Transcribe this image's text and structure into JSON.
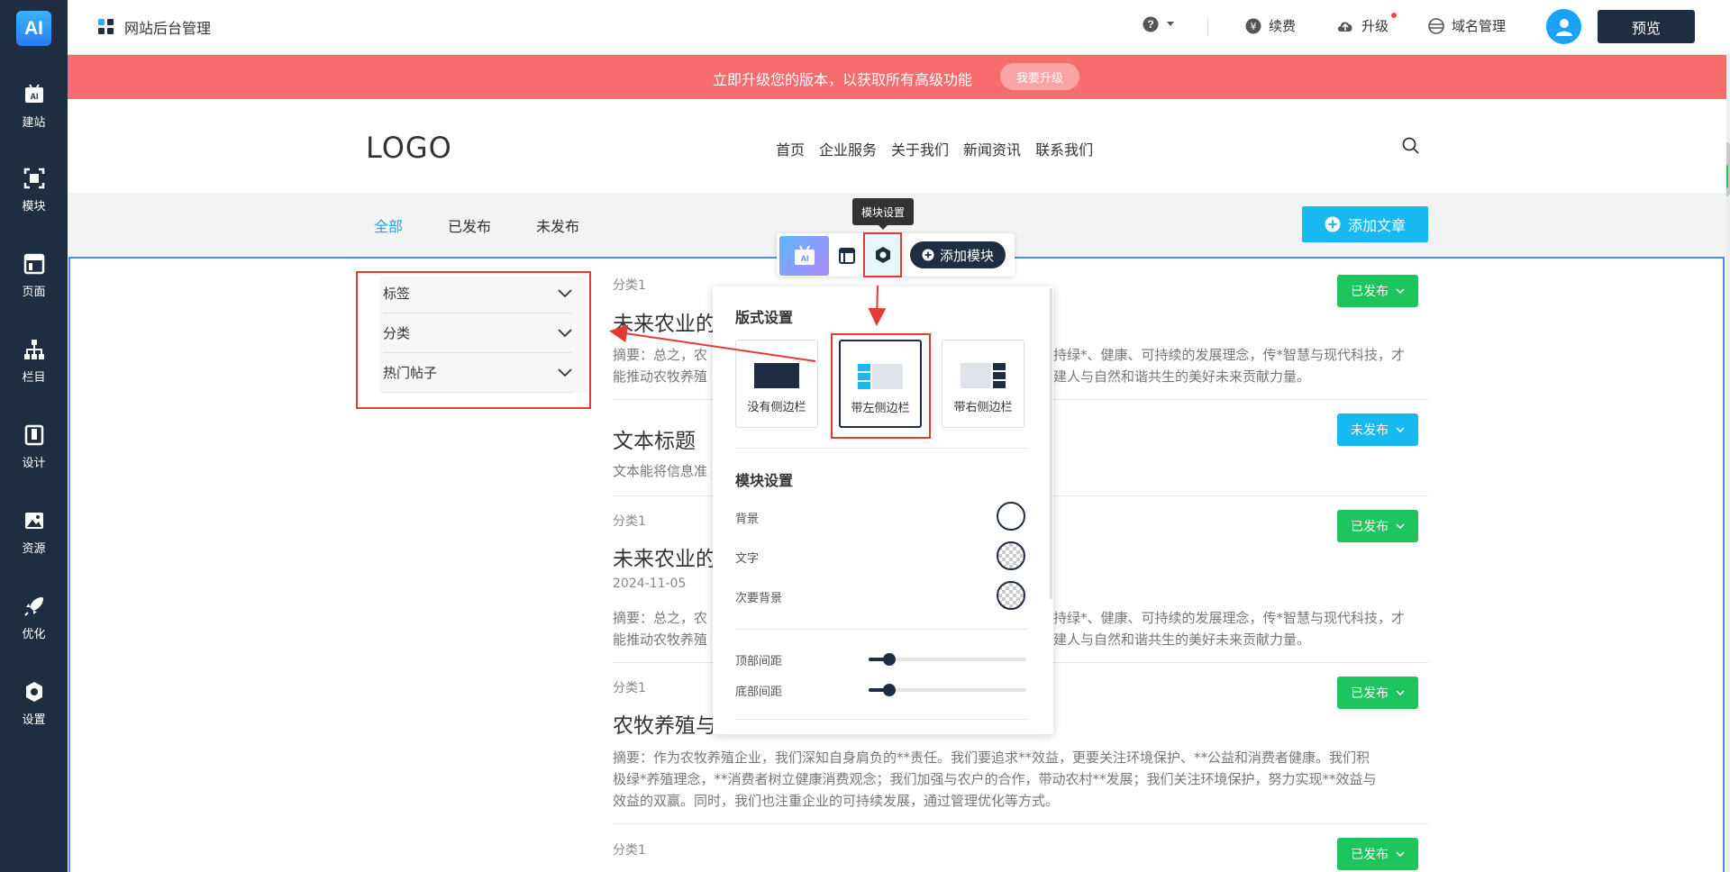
{
  "app": {
    "logo": "AI",
    "title": "网站后台管理"
  },
  "leftnav": [
    {
      "label": "建站",
      "icon": "ai-build-icon"
    },
    {
      "label": "模块",
      "icon": "module-icon"
    },
    {
      "label": "页面",
      "icon": "page-icon"
    },
    {
      "label": "栏目",
      "icon": "sitemap-icon"
    },
    {
      "label": "设计",
      "icon": "design-icon"
    },
    {
      "label": "资源",
      "icon": "image-icon"
    },
    {
      "label": "优化",
      "icon": "rocket-icon"
    },
    {
      "label": "设置",
      "icon": "gear-icon"
    }
  ],
  "topbar": {
    "renew": "续费",
    "upgrade": "升级",
    "domain": "域名管理",
    "preview": "预览"
  },
  "banner": {
    "text": "立即升级您的版本，以获取所有高级功能",
    "button": "我要升级"
  },
  "site": {
    "logo": "LOGO",
    "nav": [
      "首页",
      "企业服务",
      "关于我们",
      "新闻资讯",
      "联系我们"
    ]
  },
  "tabs": {
    "all": "全部",
    "published": "已发布",
    "unpublished": "未发布",
    "add_article": "添加文章"
  },
  "toolbar": {
    "tooltip": "模块设置",
    "add_module": "添加模块"
  },
  "sidebar": [
    "标签",
    "分类",
    "热门帖子"
  ],
  "articles": [
    {
      "category": "分类1",
      "title": "未来农业的",
      "summary1": "摘要：总之，农",
      "summary1_end": "持绿*、健康、可持续的发展理念，传*智慧与现代科技，才",
      "summary2": "能推动农牧养殖",
      "summary2_end": "建人与自然和谐共生的美好未来贡献力量。",
      "status": "已发布"
    },
    {
      "category": "",
      "title": "文本标题",
      "summary1": "文本能将信息准",
      "status": "未发布"
    },
    {
      "category": "分类1",
      "title": "未来农业的",
      "date": "2024-11-05",
      "summary1": "摘要：总之，农",
      "summary1_end": "持绿*、健康、可持续的发展理念，传*智慧与现代科技，才",
      "summary2": "能推动农牧养殖",
      "summary2_end": "建人与自然和谐共生的美好未来贡献力量。",
      "status": "已发布"
    },
    {
      "category": "分类1",
      "title": "农牧养殖与",
      "summary1": "摘要：作为农牧养殖企业，我们深知自身肩负的**责任。我们要追求**效益，更要关注环境保护、**公益和消费者健康。我们积",
      "summary2": "极绿*养殖理念，**消费者树立健康消费观念；我们加强与农户的合作，带动农村**发展；我们关注环境保护，努力实现**效益与",
      "summary3": "效益的双赢。同时，我们也注重企业的可持续发展，通过管理优化等方式。",
      "status": "已发布"
    },
    {
      "category": "分类1",
      "status": "已发布"
    }
  ],
  "panel": {
    "layout_title": "版式设置",
    "layouts": [
      "没有侧边栏",
      "带左侧边栏",
      "带右侧边栏"
    ],
    "selected_layout": "带左侧边栏",
    "module_title": "模块设置",
    "bg_label": "背景",
    "text_label": "文字",
    "secondary_bg_label": "次要背景",
    "top_spacing_label": "顶部间距",
    "bottom_spacing_label": "底部间距",
    "top_spacing": 0.13,
    "bottom_spacing": 0.13
  },
  "colors": {
    "nav_bg": "#1f2d42",
    "accent": "#18b8f2",
    "green": "#1ec45c",
    "banner": "#f76c6c",
    "annotation": "#e53935"
  }
}
